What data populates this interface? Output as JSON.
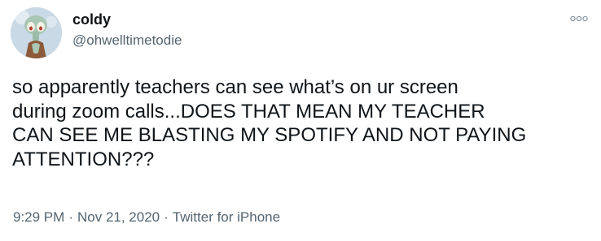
{
  "author": {
    "display_name": "coldy",
    "handle": "@ohwelltimetodie",
    "avatar_icon": "avatar-squidward-icon"
  },
  "tweet": {
    "text": "so apparently teachers can see what’s on ur screen\nduring zoom calls...DOES THAT MEAN MY TEACHER\nCAN SEE ME BLASTING MY SPOTIFY AND NOT PAYING\nATTENTION???"
  },
  "meta": {
    "time": "9:29 PM",
    "separator": "·",
    "date": "Nov 21, 2020",
    "source": "Twitter for iPhone"
  },
  "icons": {
    "more": "more-options-icon"
  },
  "colors": {
    "text": "#0f1419",
    "secondary": "#536471",
    "background": "#ffffff"
  }
}
